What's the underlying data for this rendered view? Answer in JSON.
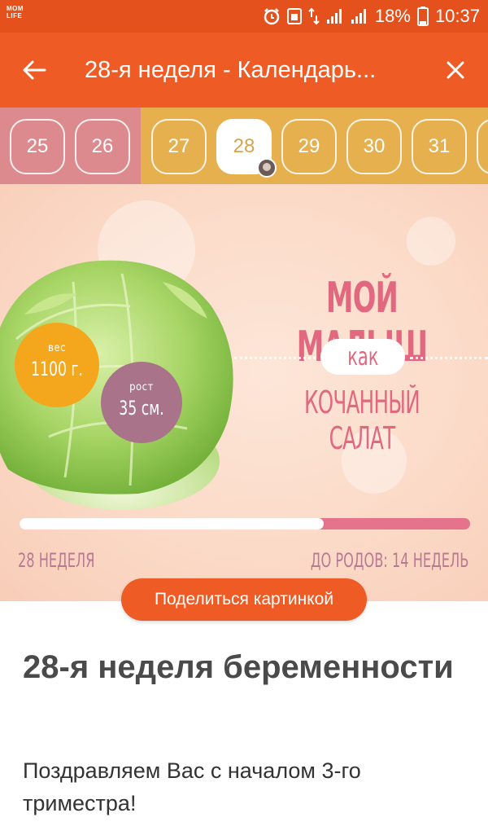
{
  "status_bar": {
    "app_logo": "MOM LIFE",
    "battery": "18%",
    "time": "10:37"
  },
  "app_bar": {
    "title": "28-я неделя - Календарь..."
  },
  "week_strip": {
    "weeks": [
      "25",
      "26",
      "27",
      "28",
      "29",
      "30",
      "31"
    ],
    "active_week": "28"
  },
  "illustration": {
    "headline_top": "Мой малыш",
    "headline_like": "как",
    "headline_bottom": "Кочанный салат",
    "weight_caption": "вес",
    "weight_value": "1100 г.",
    "height_caption": "рост",
    "height_value": "35 см.",
    "progress_fraction": 0.675,
    "progress_left": "28 неделя",
    "progress_right": "до родов: 14 недель"
  },
  "share_button": "Поделиться картинкой",
  "article": {
    "title": "28-я неделя беременности",
    "text": "Поздравляем Вас с началом 3-го триместра!"
  },
  "colors": {
    "primary": "#ee5b24",
    "week_pink": "#dc8a8e",
    "week_yellow": "#e7b04f",
    "headline_pink": "#e2687f"
  }
}
